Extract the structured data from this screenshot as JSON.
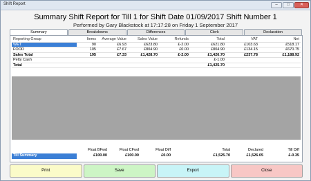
{
  "window": {
    "title": "Shift Report"
  },
  "header": {
    "title": "Summary Shift Report for Till 1 for Shift Date 01/09/2017 Shift Number 1",
    "subtitle": "Performed by Gary Blackstock at 17:17:28 on Friday 1 September 2017"
  },
  "tabs": [
    "Summary",
    "Breakdowns",
    "Differences",
    "Clerk",
    "Declaration"
  ],
  "table": {
    "columns": [
      "Reporting Group",
      "Items",
      "Average Value",
      "Sales Value",
      "Refunds",
      "Total",
      "VAT",
      "Net"
    ],
    "rows": [
      [
        "WET",
        "90",
        "£6.93",
        "£623.80",
        "£-2.00",
        "£621.80",
        "£103.63",
        "£518.17"
      ],
      [
        "FOOD",
        "105",
        "£7.67",
        "£804.90",
        "£0.00",
        "£804.90",
        "£134.15",
        "£670.75"
      ],
      [
        "Sales Total",
        "195",
        "£7.33",
        "£1,428.70",
        "£-2.00",
        "£1,426.70",
        "£237.78",
        "£1,188.92"
      ],
      [
        "Petty Cash",
        "",
        "",
        "",
        "",
        "£-1.00",
        "",
        ""
      ],
      [
        "Total",
        "",
        "",
        "",
        "",
        "£1,425.70",
        "",
        ""
      ]
    ]
  },
  "summary": {
    "columns": [
      "",
      "Float BFwd",
      "Float CFwd",
      "Float Diff",
      "Total",
      "Declared",
      "Till Diff"
    ],
    "row": [
      "Till Summary",
      "£100.00",
      "£100.00",
      "£0.00",
      "£1,525.70",
      "£1,526.05",
      "£-0.35"
    ]
  },
  "buttons": {
    "print": "Print",
    "save": "Save",
    "export": "Export",
    "close": "Close"
  },
  "colors": {
    "selection": "#3b7fd6",
    "print": "#fbfbc9",
    "save": "#cdf5c5",
    "export": "#c8f4f7",
    "close": "#f8c7c5"
  }
}
